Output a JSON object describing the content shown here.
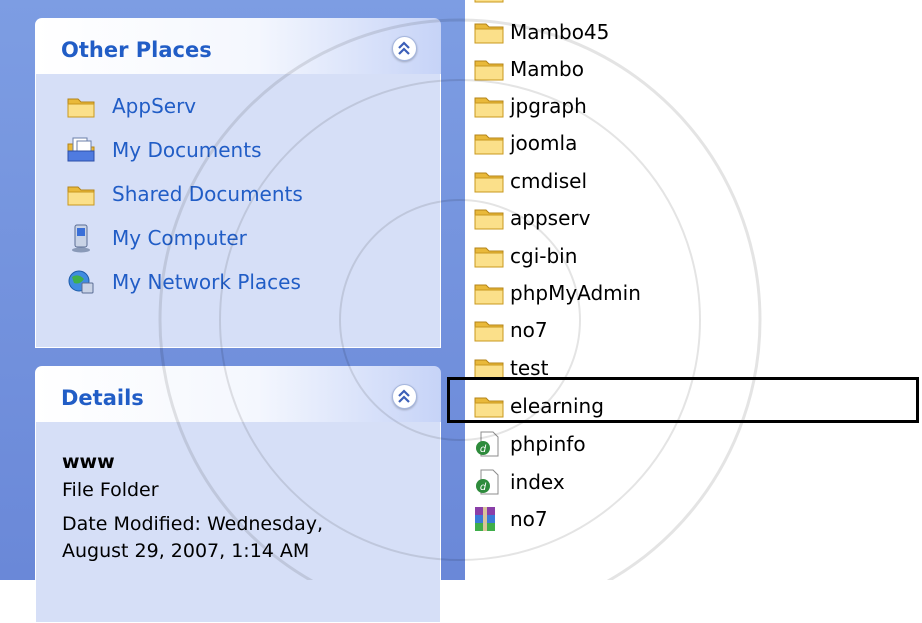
{
  "other_places": {
    "title": "Other Places",
    "items": [
      {
        "label": "AppServ",
        "icon": "folder-icon"
      },
      {
        "label": "My Documents",
        "icon": "my-documents-icon"
      },
      {
        "label": "Shared Documents",
        "icon": "folder-icon"
      },
      {
        "label": "My Computer",
        "icon": "computer-icon"
      },
      {
        "label": "My Network Places",
        "icon": "network-places-icon"
      }
    ]
  },
  "details": {
    "title": "Details",
    "name": "www",
    "type": "File Folder",
    "date_line1": "Date Modified: Wednesday,",
    "date_line2": "August 29, 2007, 1:14 AM"
  },
  "files": [
    {
      "name": "Mambo45",
      "icon": "folder-icon"
    },
    {
      "name": "Mambo",
      "icon": "folder-icon"
    },
    {
      "name": "jpgraph",
      "icon": "folder-icon"
    },
    {
      "name": "joomla",
      "icon": "folder-icon"
    },
    {
      "name": "cmdisel",
      "icon": "folder-icon"
    },
    {
      "name": "appserv",
      "icon": "folder-icon"
    },
    {
      "name": "cgi-bin",
      "icon": "folder-icon"
    },
    {
      "name": "phpMyAdmin",
      "icon": "folder-icon"
    },
    {
      "name": "no7",
      "icon": "folder-icon"
    },
    {
      "name": "test",
      "icon": "folder-icon"
    },
    {
      "name": "elearning",
      "icon": "folder-icon"
    },
    {
      "name": "phpinfo",
      "icon": "php-file-icon"
    },
    {
      "name": "index",
      "icon": "php-file-icon"
    },
    {
      "name": "no7",
      "icon": "rar-archive-icon"
    }
  ],
  "colors": {
    "pane_bg": "#7d9de3",
    "panel_body": "#d6dff7",
    "link": "#215dc6",
    "folder": "#f4d35e"
  }
}
